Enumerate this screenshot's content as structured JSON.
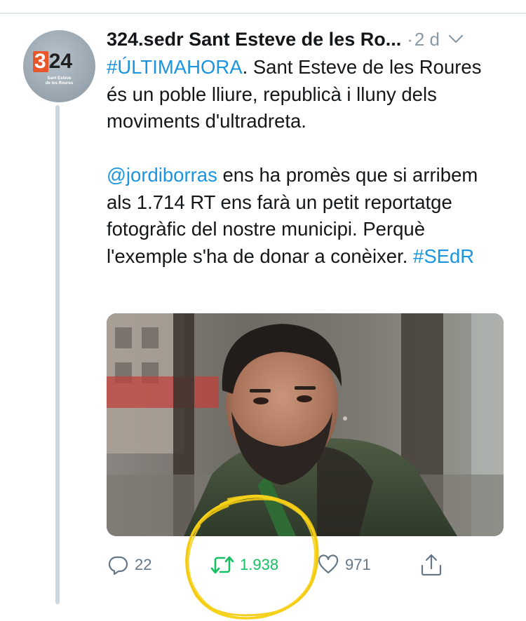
{
  "tweet": {
    "display_name": "324.sedr Sant Esteve de les Ro...",
    "separator": "·",
    "time": "2 d",
    "avatar": {
      "logo_three": "3",
      "logo_digits": "24",
      "caption_line1": "Sant Esteve",
      "caption_line2": "de les Roures"
    },
    "text": {
      "hashtag_breaking": "#ÚLTIMAHORA",
      "paragraph1_rest": ". Sant Esteve de les Roures és un poble lliure, republicà i lluny dels moviments d'ultradreta.",
      "mention": "@jordiborras",
      "paragraph2_rest": " ens ha promès que si arribem als 1.714 RT ens farà un petit reportatge fotogràfic del nostre municipi. Perquè l'exemple s'ha de donar a conèixer. ",
      "hashtag_end": "#SEdR"
    },
    "actions": {
      "reply_count": "22",
      "retweet_count": "1.938",
      "like_count": "971"
    }
  },
  "colors": {
    "link": "#1b95e0",
    "retweet_active": "#17bf63",
    "muted": "#657786",
    "highlight_circle": "#f7d21b",
    "logo_orange": "#e8562a"
  },
  "icons": {
    "reply": "reply-icon",
    "retweet": "retweet-icon",
    "like": "heart-icon",
    "share": "share-icon",
    "menu": "chevron-down-icon"
  }
}
